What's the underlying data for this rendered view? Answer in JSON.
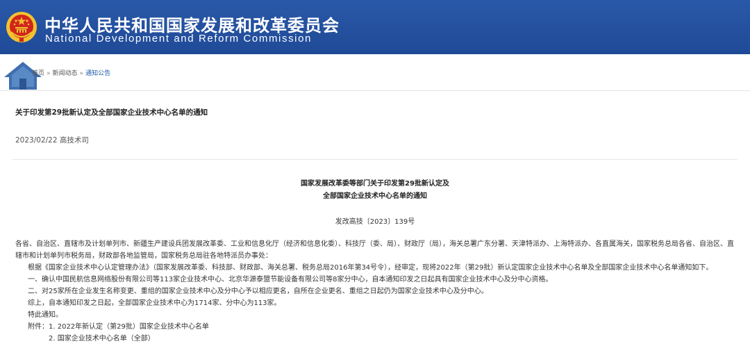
{
  "site": {
    "title_cn": "中华人民共和国国家发展和改革委员会",
    "title_en": "National Development and Reform Commission"
  },
  "breadcrumb": {
    "home": "首页",
    "separator": "»",
    "level1": "新闻动态",
    "level2": "通知公告"
  },
  "article": {
    "title": "关于印发第29批新认定及全部国家企业技术中心名单的通知",
    "meta": "2023/02/22 高技术司"
  },
  "document": {
    "heading_line1": "国家发展改革委等部门关于印发第29批新认定及",
    "heading_line2": "全部国家企业技术中心名单的通知",
    "doc_number": "发改高技〔2023〕139号",
    "addressees": "各省、自治区、直辖市及计划单列市、新疆生产建设兵团发展改革委、工业和信息化厅（经济和信息化委）、科技厅（委、局）、财政厅（局），海关总署广东分署、天津特派办、上海特派办、各直属海关，国家税务总局各省、自治区、直辖市和计划单列市税务局，财政部各地监管局，国家税务总局驻各地特派员办事处：",
    "para1": "根据《国家企业技术中心认定管理办法》（国家发展改革委、科技部、财政部、海关总署、税务总局2016年第34号令），经审定，现将2022年（第29批）新认定国家企业技术中心名单及全部国家企业技术中心名单通知如下。",
    "para2": "一、确认中国民航信息网络股份有限公司等113家企业技术中心、北京华源泰盟节能设备有限公司等8家分中心，自本通知印发之日起具有国家企业技术中心及分中心资格。",
    "para3": "二、对25家所在企业发生名称变更、重组的国家企业技术中心及分中心予以相应更名，自所在企业更名、重组之日起仍为国家企业技术中心及分中心。",
    "para4": "综上，自本通知印发之日起，全部国家企业技术中心为1714家、分中心为113家。",
    "para5": "特此通知。",
    "attach1": "附件：1. 2022年新认定（第29批）国家企业技术中心名单",
    "attach2": "2. 国家企业技术中心名单（全部）"
  },
  "colors": {
    "banner": "#1f4a97",
    "link": "#1a5aa8",
    "emblem_red": "#d0251c",
    "emblem_gold": "#f2c230"
  },
  "icons": {
    "emblem": "national-emblem-icon",
    "home": "house-icon"
  }
}
